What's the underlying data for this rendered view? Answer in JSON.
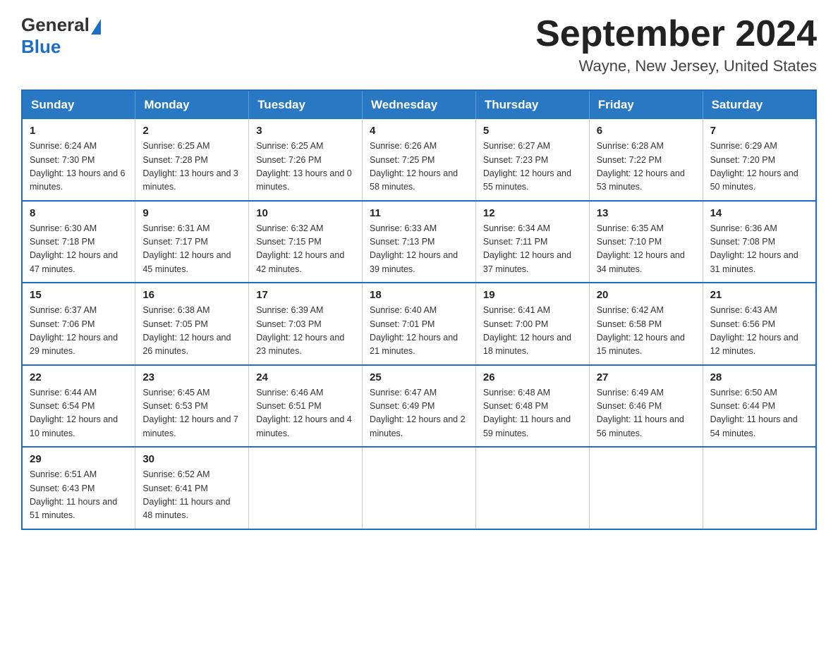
{
  "header": {
    "logo_general": "General",
    "logo_blue": "Blue",
    "month_title": "September 2024",
    "location": "Wayne, New Jersey, United States"
  },
  "days_of_week": [
    "Sunday",
    "Monday",
    "Tuesday",
    "Wednesday",
    "Thursday",
    "Friday",
    "Saturday"
  ],
  "weeks": [
    [
      {
        "day": "1",
        "sunrise": "Sunrise: 6:24 AM",
        "sunset": "Sunset: 7:30 PM",
        "daylight": "Daylight: 13 hours and 6 minutes."
      },
      {
        "day": "2",
        "sunrise": "Sunrise: 6:25 AM",
        "sunset": "Sunset: 7:28 PM",
        "daylight": "Daylight: 13 hours and 3 minutes."
      },
      {
        "day": "3",
        "sunrise": "Sunrise: 6:25 AM",
        "sunset": "Sunset: 7:26 PM",
        "daylight": "Daylight: 13 hours and 0 minutes."
      },
      {
        "day": "4",
        "sunrise": "Sunrise: 6:26 AM",
        "sunset": "Sunset: 7:25 PM",
        "daylight": "Daylight: 12 hours and 58 minutes."
      },
      {
        "day": "5",
        "sunrise": "Sunrise: 6:27 AM",
        "sunset": "Sunset: 7:23 PM",
        "daylight": "Daylight: 12 hours and 55 minutes."
      },
      {
        "day": "6",
        "sunrise": "Sunrise: 6:28 AM",
        "sunset": "Sunset: 7:22 PM",
        "daylight": "Daylight: 12 hours and 53 minutes."
      },
      {
        "day": "7",
        "sunrise": "Sunrise: 6:29 AM",
        "sunset": "Sunset: 7:20 PM",
        "daylight": "Daylight: 12 hours and 50 minutes."
      }
    ],
    [
      {
        "day": "8",
        "sunrise": "Sunrise: 6:30 AM",
        "sunset": "Sunset: 7:18 PM",
        "daylight": "Daylight: 12 hours and 47 minutes."
      },
      {
        "day": "9",
        "sunrise": "Sunrise: 6:31 AM",
        "sunset": "Sunset: 7:17 PM",
        "daylight": "Daylight: 12 hours and 45 minutes."
      },
      {
        "day": "10",
        "sunrise": "Sunrise: 6:32 AM",
        "sunset": "Sunset: 7:15 PM",
        "daylight": "Daylight: 12 hours and 42 minutes."
      },
      {
        "day": "11",
        "sunrise": "Sunrise: 6:33 AM",
        "sunset": "Sunset: 7:13 PM",
        "daylight": "Daylight: 12 hours and 39 minutes."
      },
      {
        "day": "12",
        "sunrise": "Sunrise: 6:34 AM",
        "sunset": "Sunset: 7:11 PM",
        "daylight": "Daylight: 12 hours and 37 minutes."
      },
      {
        "day": "13",
        "sunrise": "Sunrise: 6:35 AM",
        "sunset": "Sunset: 7:10 PM",
        "daylight": "Daylight: 12 hours and 34 minutes."
      },
      {
        "day": "14",
        "sunrise": "Sunrise: 6:36 AM",
        "sunset": "Sunset: 7:08 PM",
        "daylight": "Daylight: 12 hours and 31 minutes."
      }
    ],
    [
      {
        "day": "15",
        "sunrise": "Sunrise: 6:37 AM",
        "sunset": "Sunset: 7:06 PM",
        "daylight": "Daylight: 12 hours and 29 minutes."
      },
      {
        "day": "16",
        "sunrise": "Sunrise: 6:38 AM",
        "sunset": "Sunset: 7:05 PM",
        "daylight": "Daylight: 12 hours and 26 minutes."
      },
      {
        "day": "17",
        "sunrise": "Sunrise: 6:39 AM",
        "sunset": "Sunset: 7:03 PM",
        "daylight": "Daylight: 12 hours and 23 minutes."
      },
      {
        "day": "18",
        "sunrise": "Sunrise: 6:40 AM",
        "sunset": "Sunset: 7:01 PM",
        "daylight": "Daylight: 12 hours and 21 minutes."
      },
      {
        "day": "19",
        "sunrise": "Sunrise: 6:41 AM",
        "sunset": "Sunset: 7:00 PM",
        "daylight": "Daylight: 12 hours and 18 minutes."
      },
      {
        "day": "20",
        "sunrise": "Sunrise: 6:42 AM",
        "sunset": "Sunset: 6:58 PM",
        "daylight": "Daylight: 12 hours and 15 minutes."
      },
      {
        "day": "21",
        "sunrise": "Sunrise: 6:43 AM",
        "sunset": "Sunset: 6:56 PM",
        "daylight": "Daylight: 12 hours and 12 minutes."
      }
    ],
    [
      {
        "day": "22",
        "sunrise": "Sunrise: 6:44 AM",
        "sunset": "Sunset: 6:54 PM",
        "daylight": "Daylight: 12 hours and 10 minutes."
      },
      {
        "day": "23",
        "sunrise": "Sunrise: 6:45 AM",
        "sunset": "Sunset: 6:53 PM",
        "daylight": "Daylight: 12 hours and 7 minutes."
      },
      {
        "day": "24",
        "sunrise": "Sunrise: 6:46 AM",
        "sunset": "Sunset: 6:51 PM",
        "daylight": "Daylight: 12 hours and 4 minutes."
      },
      {
        "day": "25",
        "sunrise": "Sunrise: 6:47 AM",
        "sunset": "Sunset: 6:49 PM",
        "daylight": "Daylight: 12 hours and 2 minutes."
      },
      {
        "day": "26",
        "sunrise": "Sunrise: 6:48 AM",
        "sunset": "Sunset: 6:48 PM",
        "daylight": "Daylight: 11 hours and 59 minutes."
      },
      {
        "day": "27",
        "sunrise": "Sunrise: 6:49 AM",
        "sunset": "Sunset: 6:46 PM",
        "daylight": "Daylight: 11 hours and 56 minutes."
      },
      {
        "day": "28",
        "sunrise": "Sunrise: 6:50 AM",
        "sunset": "Sunset: 6:44 PM",
        "daylight": "Daylight: 11 hours and 54 minutes."
      }
    ],
    [
      {
        "day": "29",
        "sunrise": "Sunrise: 6:51 AM",
        "sunset": "Sunset: 6:43 PM",
        "daylight": "Daylight: 11 hours and 51 minutes."
      },
      {
        "day": "30",
        "sunrise": "Sunrise: 6:52 AM",
        "sunset": "Sunset: 6:41 PM",
        "daylight": "Daylight: 11 hours and 48 minutes."
      },
      null,
      null,
      null,
      null,
      null
    ]
  ]
}
